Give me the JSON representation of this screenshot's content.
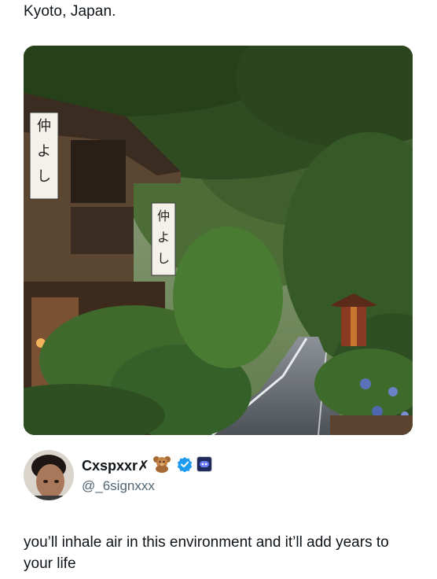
{
  "caption": "Kyoto, Japan.",
  "photo": {
    "signs": [
      "仲よし",
      "仲よし"
    ]
  },
  "author": {
    "display_name": "Cxspxxr✗",
    "handle": "@_6signxxx",
    "icons": [
      "teddy-bear-emoji",
      "verified-badge",
      "affiliate-badge"
    ],
    "verified_color": "#1d9bf0"
  },
  "tweet": {
    "text": "you’ll inhale air in this environment and it’ll add years to your life"
  }
}
